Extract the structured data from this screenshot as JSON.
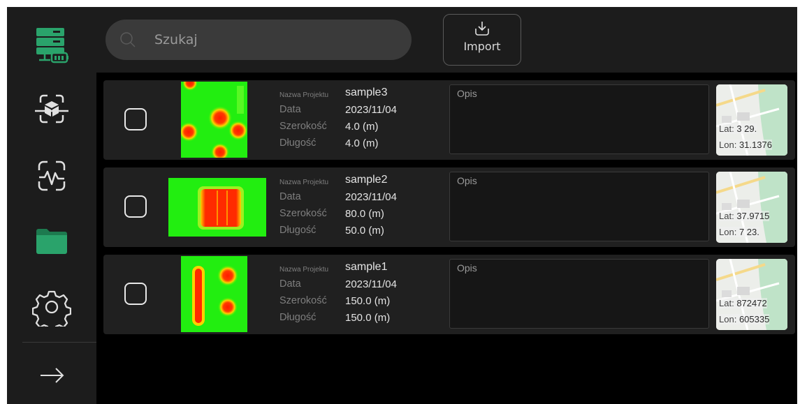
{
  "colors": {
    "accent": "#29a36a",
    "background": "#000000",
    "sidebar": "#1c1c1c",
    "row": "#202020"
  },
  "sidebar": {
    "items": [
      {
        "name": "server-status-icon",
        "active": true
      },
      {
        "name": "scan-3d-icon",
        "active": false
      },
      {
        "name": "signal-scan-icon",
        "active": false
      },
      {
        "name": "folder-icon",
        "active": true
      },
      {
        "name": "gear-icon",
        "active": false
      },
      {
        "name": "arrow-right-icon",
        "active": false
      }
    ]
  },
  "search": {
    "placeholder": "Szukaj",
    "value": ""
  },
  "import": {
    "label": "Import"
  },
  "labels": {
    "name": "Nazwa Projektu",
    "date": "Data",
    "width": "Szerokość",
    "length": "Długość",
    "description": "Opis",
    "lat": "Lat:",
    "lon": "Lon:"
  },
  "projects": [
    {
      "name": "sample3",
      "date": "2023/11/04",
      "width": "4.0 (m)",
      "length": "4.0 (m)",
      "lat": "3     29.",
      "lon": "31.1376"
    },
    {
      "name": "sample2",
      "date": "2023/11/04",
      "width": "80.0 (m)",
      "length": "50.0 (m)",
      "lat": "37.9715",
      "lon": "7     23."
    },
    {
      "name": "sample1",
      "date": "2023/11/04",
      "width": "150.0 (m)",
      "length": "150.0 (m)",
      "lat": "872472",
      "lon": "605335"
    }
  ]
}
